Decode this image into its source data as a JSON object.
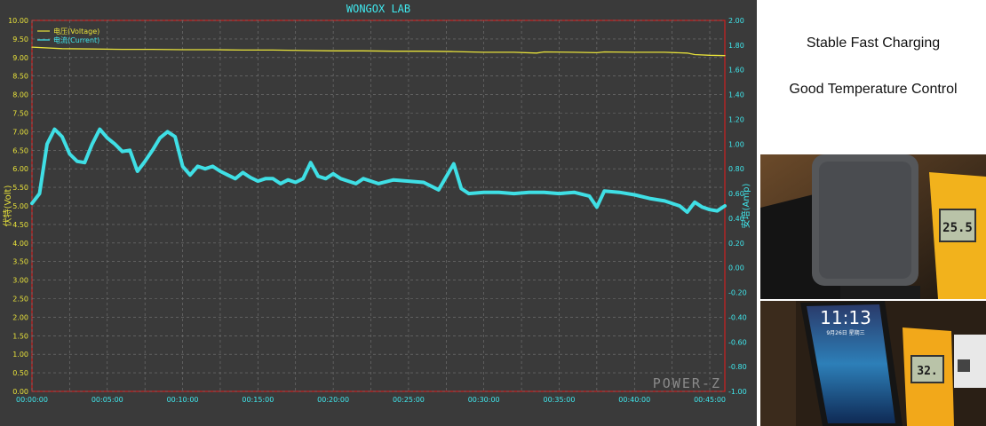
{
  "chart_data": {
    "type": "line",
    "title": "WONGOX LAB",
    "watermark": "POWER-Z",
    "y_left": {
      "label": "伏特(Volt)",
      "lim": [
        0,
        10
      ],
      "step": 0.5
    },
    "y_right": {
      "label": "安培(Amp)",
      "lim": [
        -1,
        2
      ],
      "step": 0.2
    },
    "x": {
      "lim_minutes": [
        0,
        46
      ],
      "ticks": [
        "00:00:00",
        "00:05:00",
        "00:10:00",
        "00:15:00",
        "00:20:00",
        "00:25:00",
        "00:30:00",
        "00:35:00",
        "00:40:00",
        "00:45:00"
      ]
    },
    "grid": true,
    "legend_position": "top-left",
    "series": [
      {
        "name": "电压(Voltage)",
        "axis": "left",
        "color": "#e8e23a",
        "points": [
          [
            0,
            9.28
          ],
          [
            2,
            9.24
          ],
          [
            4,
            9.23
          ],
          [
            6,
            9.22
          ],
          [
            8,
            9.22
          ],
          [
            10,
            9.21
          ],
          [
            12,
            9.21
          ],
          [
            14,
            9.2
          ],
          [
            16,
            9.2
          ],
          [
            18,
            9.19
          ],
          [
            20,
            9.18
          ],
          [
            22,
            9.18
          ],
          [
            24,
            9.17
          ],
          [
            26,
            9.17
          ],
          [
            28,
            9.16
          ],
          [
            30,
            9.14
          ],
          [
            32,
            9.14
          ],
          [
            33.5,
            9.12
          ],
          [
            34,
            9.15
          ],
          [
            36,
            9.14
          ],
          [
            37.5,
            9.13
          ],
          [
            38,
            9.15
          ],
          [
            40,
            9.14
          ],
          [
            42,
            9.14
          ],
          [
            43.5,
            9.12
          ],
          [
            44,
            9.08
          ],
          [
            45,
            9.06
          ],
          [
            46,
            9.05
          ]
        ]
      },
      {
        "name": "电流(Current)",
        "axis": "right",
        "color": "#3fe8ee",
        "points": [
          [
            0,
            0.52
          ],
          [
            0.5,
            0.6
          ],
          [
            1,
            1.0
          ],
          [
            1.5,
            1.12
          ],
          [
            2,
            1.06
          ],
          [
            2.5,
            0.92
          ],
          [
            3,
            0.86
          ],
          [
            3.5,
            0.85
          ],
          [
            4,
            1.0
          ],
          [
            4.5,
            1.12
          ],
          [
            5,
            1.05
          ],
          [
            5.5,
            1.0
          ],
          [
            6,
            0.94
          ],
          [
            6.5,
            0.95
          ],
          [
            7,
            0.78
          ],
          [
            7.5,
            0.86
          ],
          [
            8,
            0.95
          ],
          [
            8.5,
            1.05
          ],
          [
            9,
            1.1
          ],
          [
            9.5,
            1.06
          ],
          [
            10,
            0.82
          ],
          [
            10.5,
            0.75
          ],
          [
            11,
            0.82
          ],
          [
            11.5,
            0.8
          ],
          [
            12,
            0.82
          ],
          [
            12.5,
            0.78
          ],
          [
            13,
            0.75
          ],
          [
            13.5,
            0.72
          ],
          [
            14,
            0.77
          ],
          [
            14.5,
            0.73
          ],
          [
            15,
            0.7
          ],
          [
            15.5,
            0.72
          ],
          [
            16,
            0.72
          ],
          [
            16.5,
            0.68
          ],
          [
            17,
            0.71
          ],
          [
            17.5,
            0.69
          ],
          [
            18,
            0.72
          ],
          [
            18.5,
            0.85
          ],
          [
            19,
            0.74
          ],
          [
            19.5,
            0.72
          ],
          [
            20,
            0.76
          ],
          [
            20.5,
            0.72
          ],
          [
            21,
            0.7
          ],
          [
            21.5,
            0.68
          ],
          [
            22,
            0.72
          ],
          [
            23,
            0.68
          ],
          [
            24,
            0.71
          ],
          [
            25,
            0.7
          ],
          [
            26,
            0.69
          ],
          [
            27,
            0.63
          ],
          [
            28,
            0.84
          ],
          [
            28.5,
            0.64
          ],
          [
            29,
            0.6
          ],
          [
            30,
            0.61
          ],
          [
            31,
            0.61
          ],
          [
            32,
            0.6
          ],
          [
            33,
            0.61
          ],
          [
            34,
            0.61
          ],
          [
            35,
            0.6
          ],
          [
            36,
            0.61
          ],
          [
            37,
            0.58
          ],
          [
            37.5,
            0.49
          ],
          [
            38,
            0.62
          ],
          [
            39,
            0.61
          ],
          [
            40,
            0.59
          ],
          [
            41,
            0.56
          ],
          [
            42,
            0.54
          ],
          [
            43,
            0.5
          ],
          [
            43.5,
            0.45
          ],
          [
            44,
            0.53
          ],
          [
            44.5,
            0.49
          ],
          [
            45,
            0.47
          ],
          [
            45.5,
            0.46
          ],
          [
            46,
            0.5
          ]
        ]
      }
    ]
  },
  "text_panel": {
    "line1": "Stable Fast Charging",
    "line2": "Good Temperature Control"
  },
  "photos": {
    "top_thermometer_reading": "25.5",
    "bottom_thermometer_reading": "32.",
    "phone_time": "11:13",
    "phone_date": "9月26日 星期三"
  }
}
